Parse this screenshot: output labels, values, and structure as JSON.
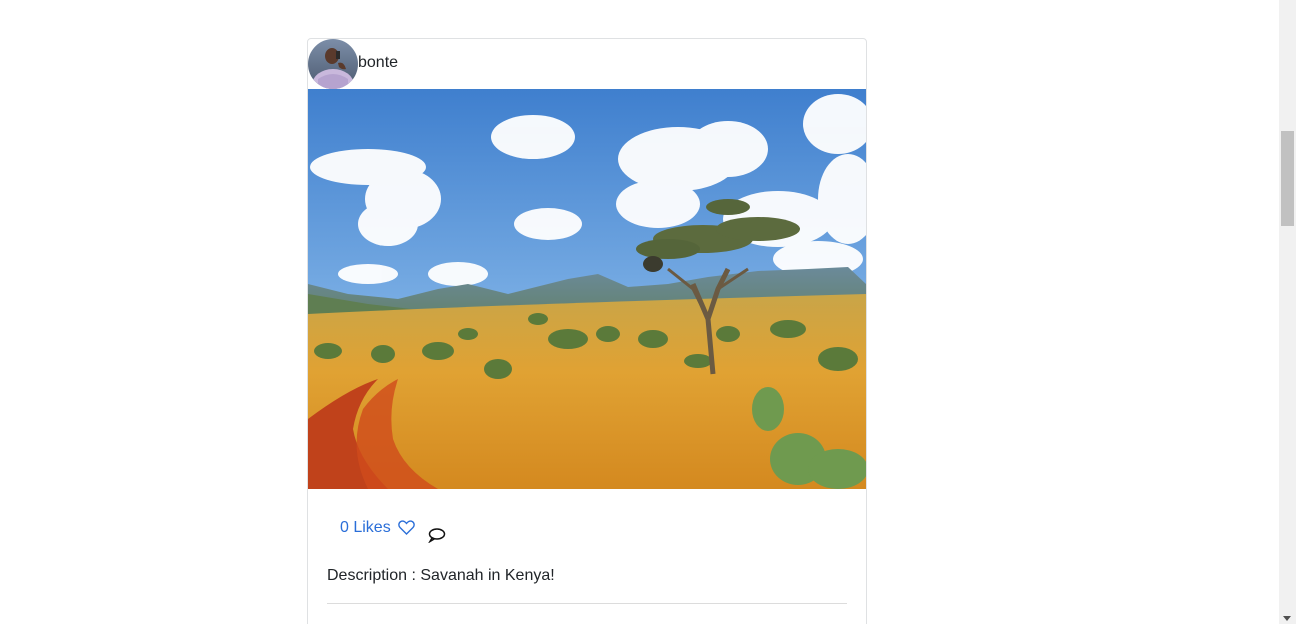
{
  "post": {
    "username": "bonte",
    "likes_label": "0 Likes",
    "description": "Description : Savanah in Kenya!",
    "image_icon": "savanna-photo",
    "avatar_icon": "user-avatar-photo"
  },
  "icons": {
    "heart": "heart-outline-icon",
    "comment": "speech-bubble-icon"
  },
  "colors": {
    "link": "#2a6ed8",
    "text": "#212529",
    "card_border": "#dfe1e3"
  }
}
